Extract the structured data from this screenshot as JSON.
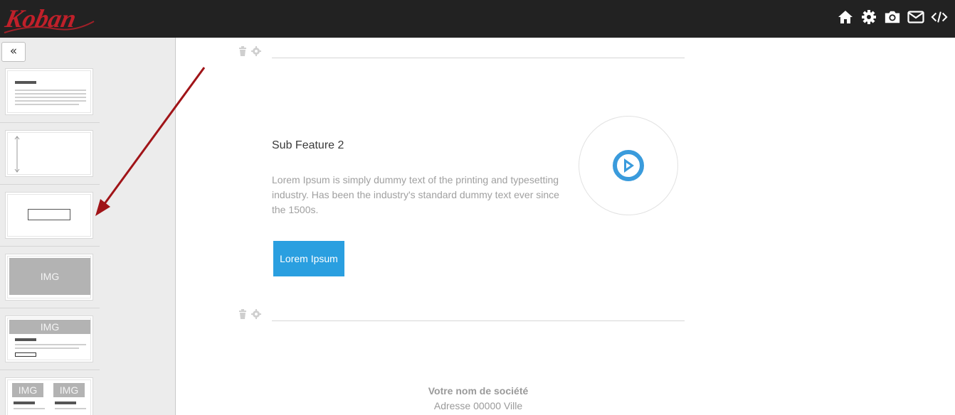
{
  "header": {
    "logo_text": "Koban",
    "logo_color": "#c0202a",
    "background": "#222222",
    "toolbar": [
      {
        "icon": "home-icon"
      },
      {
        "icon": "gear-icon"
      },
      {
        "icon": "camera-icon"
      },
      {
        "icon": "envelope-icon"
      },
      {
        "icon": "code-icon"
      }
    ]
  },
  "sidebar": {
    "collapse_label": "«",
    "blocks": [
      {
        "type": "text-block"
      },
      {
        "type": "spacer-block"
      },
      {
        "type": "button-block"
      },
      {
        "type": "image-block",
        "label": "IMG"
      },
      {
        "type": "image-text-button-block",
        "label": "IMG"
      },
      {
        "type": "two-image-columns-block",
        "labels": [
          "IMG",
          "IMG"
        ]
      }
    ]
  },
  "main": {
    "feature": {
      "title": "Sub Feature 2",
      "text": "Lorem Ipsum is simply dummy text of the printing and typesetting industry. Has been the industry's standard dummy text ever since the 1500s.",
      "button_label": "Lorem Ipsum",
      "button_color": "#2a9fe0",
      "icon": "play-circle-icon",
      "icon_color": "#3a9bdc"
    },
    "footer": {
      "company": "Votre nom de société",
      "address": "Adresse 00000 Ville"
    }
  },
  "annotation": {
    "arrow_color": "#a01418"
  }
}
